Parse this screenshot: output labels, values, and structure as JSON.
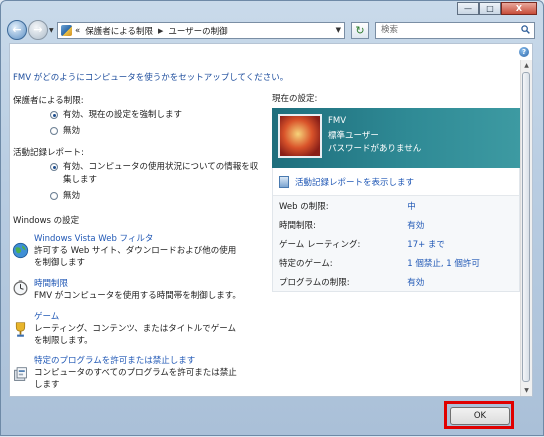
{
  "window": {
    "minimize_label": "—",
    "maximize_label": "□",
    "close_label": "X"
  },
  "address": {
    "crumbs": [
      "保護者による制限",
      "ユーザーの制御"
    ],
    "overflow": "«",
    "search_placeholder": "検索"
  },
  "intro": "FMV がどのようにコンピュータを使うかをセットアップしてください。",
  "parental": {
    "label": "保護者による制限:",
    "options": [
      "有効、現在の設定を強制します",
      "無効"
    ],
    "selected": 0
  },
  "activity": {
    "label": "活動記録レポート:",
    "options": [
      "有効、コンピュータの使用状況についての情報を収集します",
      "無効"
    ],
    "selected": 0
  },
  "windows_settings": {
    "label": "Windows の設定",
    "items": [
      {
        "title": "Windows Vista Web フィルタ",
        "desc": "許可する Web サイト、ダウンロードおよび他の使用を制御します",
        "icon": "globe-icon"
      },
      {
        "title": "時間制限",
        "desc": "FMV がコンピュータを使用する時間帯を制御します。",
        "icon": "clock-icon"
      },
      {
        "title": "ゲーム",
        "desc": "レーティング、コンテンツ、またはタイトルでゲームを制限します。",
        "icon": "trophy-icon"
      },
      {
        "title": "特定のプログラムを許可または禁止します",
        "desc": "コンピュータのすべてのプログラムを許可または禁止します",
        "icon": "program-icon"
      }
    ]
  },
  "current_settings": {
    "label": "現在の設定:",
    "user_name": "FMV",
    "user_role": "標準ユーザー",
    "user_password": "パスワードがありません",
    "report_link": "活動記録レポートを表示します",
    "rows": [
      {
        "key": "Web の制限:",
        "value": "中"
      },
      {
        "key": "時間制限:",
        "value": "有効"
      },
      {
        "key": "ゲーム レーティング:",
        "value": "17+ まで"
      },
      {
        "key": "特定のゲーム:",
        "value": "1 個禁止, 1 個許可"
      },
      {
        "key": "プログラムの制限:",
        "value": "有効"
      }
    ]
  },
  "footer": {
    "ok_label": "OK",
    "highlight_color": "#e00000"
  }
}
